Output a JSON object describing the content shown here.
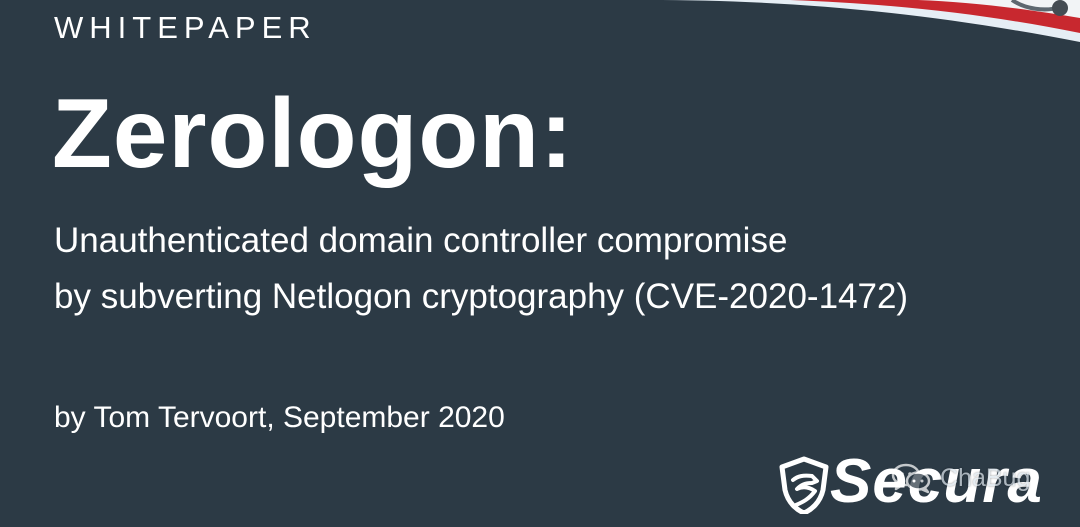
{
  "document": {
    "kicker": "WHITEPAPER",
    "title": "Zerologon:",
    "subtitle_line_1": "Unauthenticated domain controller compromise",
    "subtitle_line_2": "by subverting Netlogon cryptography (CVE-2020-1472)",
    "author_date": "by Tom Tervoort, September 2020"
  },
  "branding": {
    "company": "Secura",
    "watermark_text": "ChaBug",
    "icons": {
      "logo": "shield-icon",
      "watermark": "chat-bubbles-icon"
    }
  },
  "colors": {
    "background": "#2c3a45",
    "text": "#ffffff",
    "accent_red": "#c8282f",
    "accent_light": "#e6eef5"
  }
}
